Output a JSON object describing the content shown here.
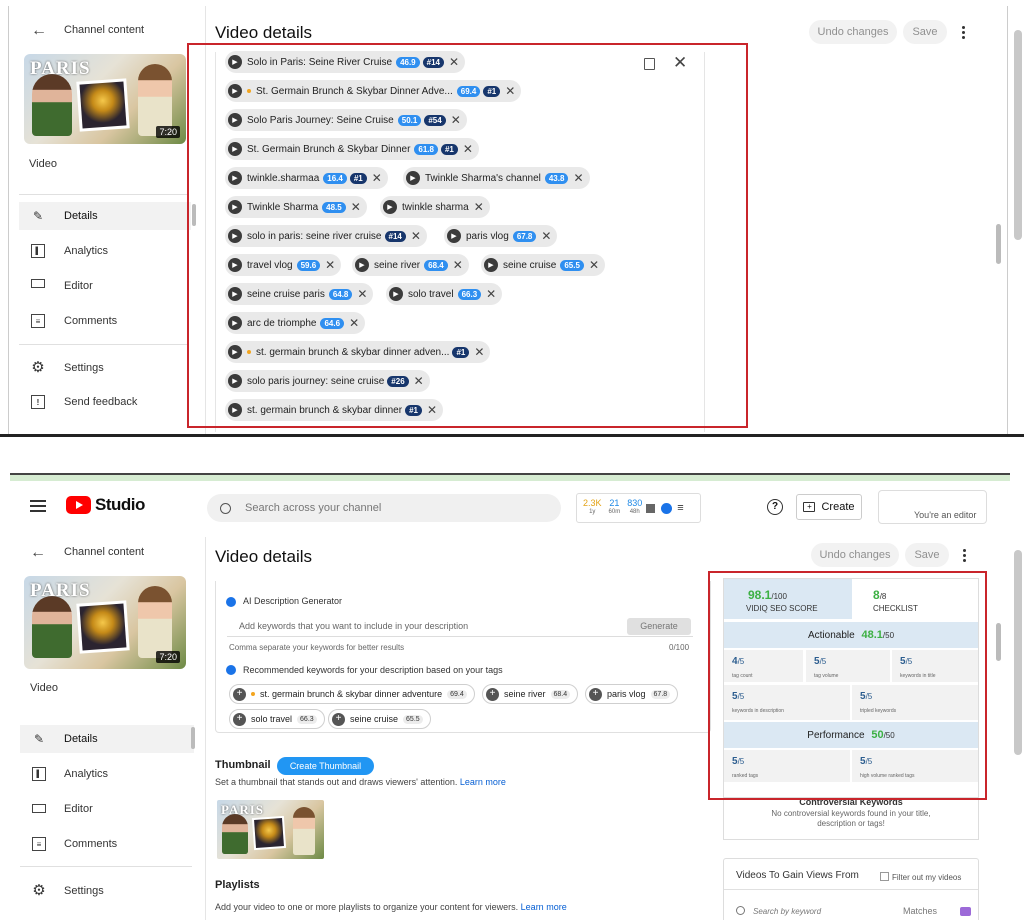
{
  "top_panel": {
    "channel_content": "Channel content",
    "video_label": "Video",
    "thumb_text": "PARIS",
    "duration": "7:20",
    "nav": [
      {
        "label": "Details",
        "icon": "pencil-icon"
      },
      {
        "label": "Analytics",
        "icon": "analytics-icon"
      },
      {
        "label": "Editor",
        "icon": "editor-icon"
      },
      {
        "label": "Comments",
        "icon": "comments-icon"
      }
    ],
    "settings": "Settings",
    "feedback": "Send feedback",
    "page_title": "Video details",
    "undo": "Undo changes",
    "save": "Save",
    "tags": [
      {
        "text": "Solo in Paris: Seine River Cruise",
        "score": "46.9",
        "rank": "#14"
      },
      {
        "text": "St. Germain Brunch & Skybar Dinner Adve...",
        "dot": true,
        "score": "69.4",
        "rank": "#1"
      },
      {
        "text": "Solo Paris Journey: Seine Cruise",
        "score": "50.1",
        "rank": "#54"
      },
      {
        "text": "St. Germain Brunch & Skybar Dinner",
        "score": "61.8",
        "rank": "#1"
      },
      {
        "text": "twinkle.sharmaa",
        "score": "16.4",
        "rank": "#1"
      },
      {
        "text": "Twinkle Sharma's channel",
        "score": "43.8"
      },
      {
        "text": "Twinkle Sharma",
        "score": "48.5"
      },
      {
        "text": "twinkle sharma"
      },
      {
        "text": "solo in paris: seine river cruise",
        "rank": "#14"
      },
      {
        "text": "paris vlog",
        "score": "67.8"
      },
      {
        "text": "travel vlog",
        "score": "59.6"
      },
      {
        "text": "seine river",
        "score": "68.4"
      },
      {
        "text": "seine cruise",
        "score": "65.5"
      },
      {
        "text": "seine cruise paris",
        "score": "64.8"
      },
      {
        "text": "solo travel",
        "score": "66.3"
      },
      {
        "text": "arc de triomphe",
        "score": "64.6"
      },
      {
        "text": "st. germain brunch & skybar dinner adven...",
        "dot": true,
        "rank": "#1"
      },
      {
        "text": "solo paris journey: seine cruise",
        "rank": "#26"
      },
      {
        "text": "st. germain brunch & skybar dinner",
        "rank": "#1"
      }
    ]
  },
  "bottom_panel": {
    "logo_text": "Studio",
    "search_placeholder": "Search across your channel",
    "stats": [
      {
        "value": "2.3K",
        "sub": "1y",
        "color": "#e3a317"
      },
      {
        "value": "21",
        "sub": "60m",
        "color": "#1e88e5"
      },
      {
        "value": "830",
        "sub": "48h",
        "color": "#1e88e5"
      }
    ],
    "create": "Create",
    "editor_text": "You're an editor",
    "channel_content": "Channel content",
    "video_label": "Video",
    "thumb_text": "PARIS",
    "duration": "7:20",
    "nav": [
      {
        "label": "Details",
        "icon": "pencil-icon"
      },
      {
        "label": "Analytics",
        "icon": "analytics-icon"
      },
      {
        "label": "Editor",
        "icon": "editor-icon"
      },
      {
        "label": "Comments",
        "icon": "comments-icon"
      }
    ],
    "settings": "Settings",
    "page_title": "Video details",
    "undo": "Undo changes",
    "save": "Save",
    "ai_title": "AI Description Generator",
    "ai_placeholder": "Add keywords that you want to include in your description",
    "generate": "Generate",
    "comma_hint": "Comma separate your keywords for better results",
    "counter": "0/100",
    "rec_title": "Recommended keywords for your description based on your tags",
    "rec_keywords": [
      {
        "text": "st. germain brunch & skybar dinner adventure",
        "score": "69.4",
        "dot": true
      },
      {
        "text": "seine river",
        "score": "68.4"
      },
      {
        "text": "paris vlog",
        "score": "67.8"
      },
      {
        "text": "solo travel",
        "score": "66.3"
      },
      {
        "text": "seine cruise",
        "score": "65.5"
      }
    ],
    "thumbnail_title": "Thumbnail",
    "create_thumbnail": "Create Thumbnail",
    "thumbnail_desc": "Set a thumbnail that stands out and draws viewers' attention.",
    "learn_more": "Learn more",
    "playlists_title": "Playlists",
    "playlists_desc": "Add your video to one or more playlists to organize your content for viewers.",
    "seo": {
      "score": "98.1",
      "score_max": "/100",
      "score_label": "VIDIQ SEO SCORE",
      "checklist": "8",
      "checklist_max": "/8",
      "checklist_label": "CHECKLIST",
      "actionable_label": "Actionable",
      "actionable_score": "48.1",
      "actionable_max": "/50",
      "actionable_cells": [
        {
          "v": "4",
          "max": "/5",
          "l": "tag count"
        },
        {
          "v": "5",
          "max": "/5",
          "l": "tag volume"
        },
        {
          "v": "5",
          "max": "/5",
          "l": "keywords in title"
        },
        {
          "v": "5",
          "max": "/5",
          "l": "keywords in description"
        },
        {
          "v": "5",
          "max": "/5",
          "l": "tripled keywords"
        }
      ],
      "performance_label": "Performance",
      "performance_score": "50",
      "performance_max": "/50",
      "performance_cells": [
        {
          "v": "5",
          "max": "/5",
          "l": "ranked tags"
        },
        {
          "v": "5",
          "max": "/5",
          "l": "high volume ranked tags"
        }
      ]
    },
    "controversial_title": "Controversial Keywords",
    "controversial_desc": "No controversial keywords found in your title, description or tags!",
    "gain_title": "Videos To Gain Views From",
    "filter_label": "Filter out my videos",
    "search_keyword": "Search by keyword",
    "matches": "Matches"
  },
  "colors": {
    "youtube_red": "#ff0000",
    "annotation_red": "#c9252b",
    "link_blue": "#065fd4",
    "score_green": "#3cb043",
    "seo_header": "#dbe8f3"
  }
}
